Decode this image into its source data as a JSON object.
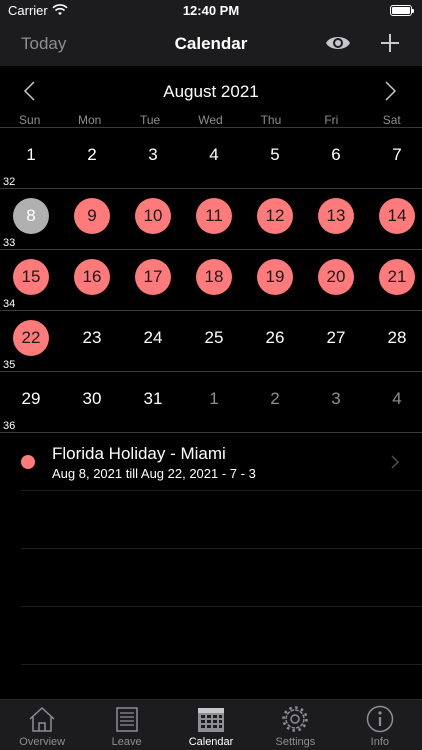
{
  "status_bar": {
    "carrier": "Carrier",
    "time": "12:40 PM"
  },
  "nav": {
    "today_label": "Today",
    "title": "Calendar",
    "eye_icon": "eye-icon",
    "plus_icon": "plus-icon"
  },
  "month": {
    "title": "August 2021"
  },
  "weekdays": [
    "Sun",
    "Mon",
    "Tue",
    "Wed",
    "Thu",
    "Fri",
    "Sat"
  ],
  "weeks": [
    {
      "num": "32",
      "days": [
        {
          "d": "1",
          "state": "normal"
        },
        {
          "d": "2",
          "state": "normal"
        },
        {
          "d": "3",
          "state": "normal"
        },
        {
          "d": "4",
          "state": "normal"
        },
        {
          "d": "5",
          "state": "normal"
        },
        {
          "d": "6",
          "state": "normal"
        },
        {
          "d": "7",
          "state": "normal"
        }
      ]
    },
    {
      "num": "33",
      "days": [
        {
          "d": "8",
          "state": "today"
        },
        {
          "d": "9",
          "state": "selected"
        },
        {
          "d": "10",
          "state": "selected"
        },
        {
          "d": "11",
          "state": "selected"
        },
        {
          "d": "12",
          "state": "selected"
        },
        {
          "d": "13",
          "state": "selected"
        },
        {
          "d": "14",
          "state": "selected"
        }
      ]
    },
    {
      "num": "34",
      "days": [
        {
          "d": "15",
          "state": "selected"
        },
        {
          "d": "16",
          "state": "selected"
        },
        {
          "d": "17",
          "state": "selected"
        },
        {
          "d": "18",
          "state": "selected"
        },
        {
          "d": "19",
          "state": "selected"
        },
        {
          "d": "20",
          "state": "selected"
        },
        {
          "d": "21",
          "state": "selected"
        }
      ]
    },
    {
      "num": "35",
      "days": [
        {
          "d": "22",
          "state": "selected"
        },
        {
          "d": "23",
          "state": "normal"
        },
        {
          "d": "24",
          "state": "normal"
        },
        {
          "d": "25",
          "state": "normal"
        },
        {
          "d": "26",
          "state": "normal"
        },
        {
          "d": "27",
          "state": "normal"
        },
        {
          "d": "28",
          "state": "normal"
        }
      ]
    },
    {
      "num": "36",
      "days": [
        {
          "d": "29",
          "state": "normal"
        },
        {
          "d": "30",
          "state": "normal"
        },
        {
          "d": "31",
          "state": "normal"
        },
        {
          "d": "1",
          "state": "other"
        },
        {
          "d": "2",
          "state": "other"
        },
        {
          "d": "3",
          "state": "other"
        },
        {
          "d": "4",
          "state": "other"
        }
      ]
    }
  ],
  "events": [
    {
      "title": "Florida Holiday - Miami",
      "subtitle": "Aug 8, 2021 till Aug 22, 2021 - 7 - 3",
      "color": "#ff7a7a"
    }
  ],
  "tabs": [
    {
      "label": "Overview",
      "icon": "house-icon",
      "active": false
    },
    {
      "label": "Leave",
      "icon": "document-icon",
      "active": false
    },
    {
      "label": "Calendar",
      "icon": "calendar-icon",
      "active": true
    },
    {
      "label": "Settings",
      "icon": "gear-icon",
      "active": false
    },
    {
      "label": "Info",
      "icon": "info-icon",
      "active": false
    }
  ],
  "colors": {
    "accent": "#ff7a7a",
    "today": "#b0b0b0",
    "bar": "#1c1c1e"
  }
}
